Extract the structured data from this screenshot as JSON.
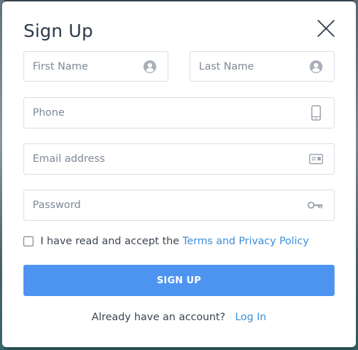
{
  "modal": {
    "title": "Sign Up",
    "close_icon": "close-icon"
  },
  "form": {
    "first_name": {
      "placeholder": "First Name",
      "value": "",
      "icon": "user-circle-icon"
    },
    "last_name": {
      "placeholder": "Last Name",
      "value": "",
      "icon": "user-circle-icon"
    },
    "phone": {
      "placeholder": "Phone",
      "value": "",
      "icon": "phone-icon"
    },
    "email": {
      "placeholder": "Email address",
      "value": "",
      "icon": "id-card-icon"
    },
    "password": {
      "placeholder": "Password",
      "value": "",
      "icon": "key-icon"
    },
    "terms": {
      "checked": false,
      "text": "I have read and accept the",
      "link_text": "Terms and Privacy Policy"
    },
    "submit_label": "SIGN UP"
  },
  "footer": {
    "text": "Already have an account?",
    "link_text": "Log In"
  },
  "colors": {
    "accent": "#4d94f1",
    "link": "#3b8fd8",
    "title": "#2d3a4a",
    "border": "#d9dde3",
    "placeholder": "#7e8896"
  }
}
